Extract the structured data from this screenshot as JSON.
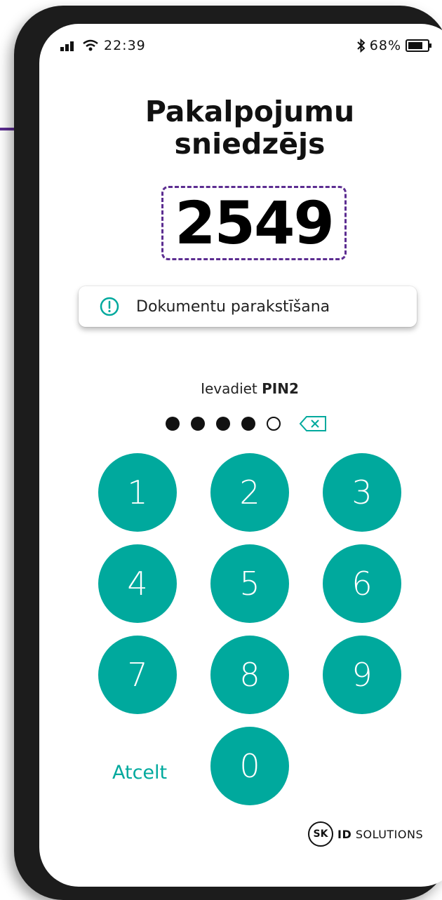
{
  "status_bar": {
    "time": "22:39",
    "battery": "68%",
    "signal_icon": "signal-bars-icon",
    "wifi_icon": "wifi-icon",
    "bluetooth_icon": "bluetooth-icon",
    "battery_icon": "battery-icon"
  },
  "header": {
    "title_line1": "Pakalpojumu",
    "title_line2": "sniedzējs"
  },
  "verification_code": "2549",
  "info_card": {
    "icon": "info-icon",
    "text": "Dokumentu parakstīšana"
  },
  "pin_prompt": {
    "prefix": "Ievadiet ",
    "pin_name": "PIN2",
    "entered": 4,
    "length": 5
  },
  "keypad": {
    "keys": [
      "1",
      "2",
      "3",
      "4",
      "5",
      "6",
      "7",
      "8",
      "9",
      "0"
    ],
    "cancel_label": "Atcelt"
  },
  "logo": {
    "badge": "SK",
    "brand": "ID",
    "suffix": " SOLUTIONS"
  },
  "colors": {
    "accent": "#00a99d",
    "arrow": "#5c2d91",
    "code_border": "#5c2d91"
  }
}
